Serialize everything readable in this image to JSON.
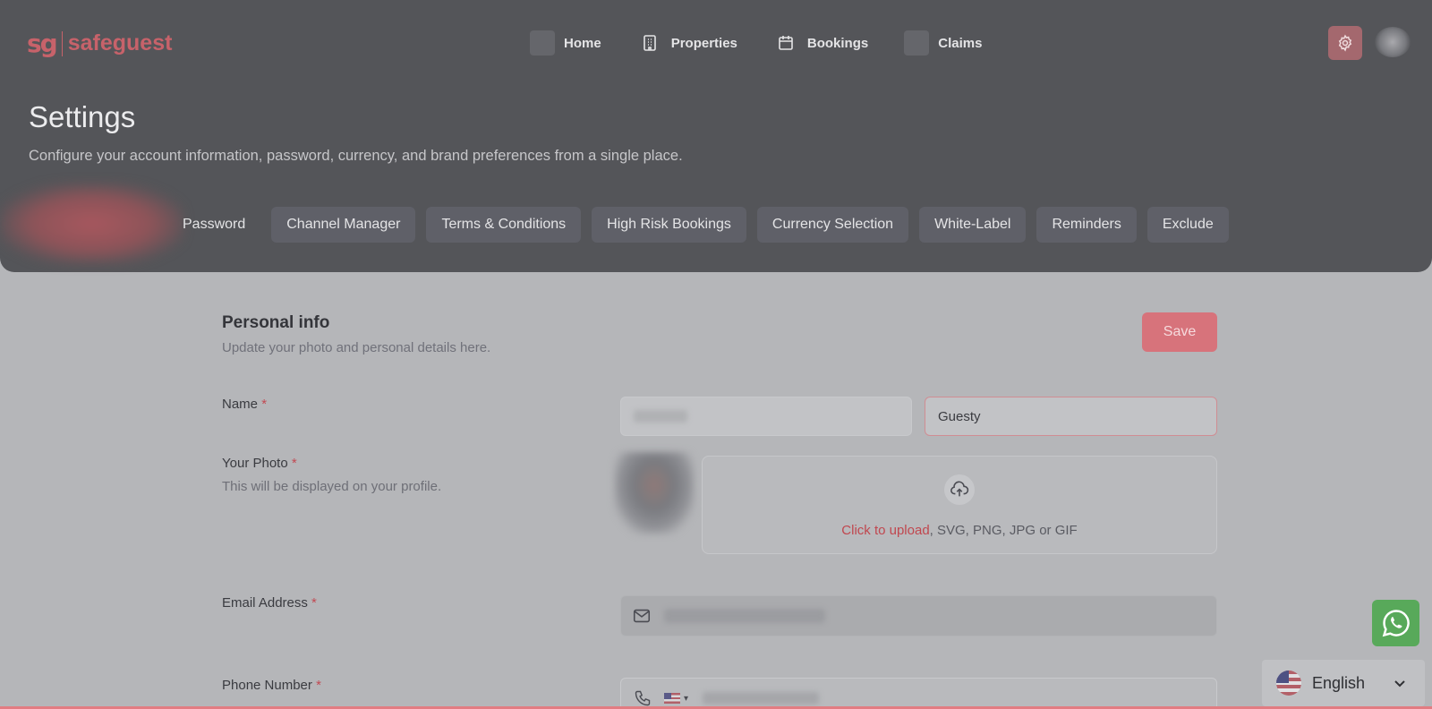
{
  "brand": {
    "mark": "sg",
    "name": "safeguest"
  },
  "nav": {
    "items": [
      {
        "label": "Home",
        "icon": "home-icon"
      },
      {
        "label": "Properties",
        "icon": "building-icon"
      },
      {
        "label": "Bookings",
        "icon": "calendar-icon"
      },
      {
        "label": "Claims",
        "icon": "claims-icon"
      }
    ]
  },
  "header": {
    "title": "Settings",
    "subtitle": "Configure your account information, password, currency, and brand preferences from a single place."
  },
  "tabs": [
    "Password",
    "Channel Manager",
    "Terms & Conditions",
    "High Risk Bookings",
    "Currency Selection",
    "White-Label",
    "Reminders",
    "Exclude"
  ],
  "personal_info": {
    "title": "Personal info",
    "subtitle": "Update your photo and personal details here.",
    "save_label": "Save",
    "required_mark": "*",
    "name_label": "Name",
    "last_name_value": "Guesty",
    "photo_label": "Your Photo",
    "photo_help": "This will be displayed on your profile.",
    "upload_link": "Click to upload",
    "upload_formats": ", SVG, PNG, JPG or GIF",
    "email_label": "Email Address",
    "phone_label": "Phone Number",
    "phone_country_caret": "▾"
  },
  "language": {
    "label": "English"
  },
  "colors": {
    "accent": "#d7737b",
    "link": "#c0474f",
    "whatsapp": "#58a95a"
  }
}
